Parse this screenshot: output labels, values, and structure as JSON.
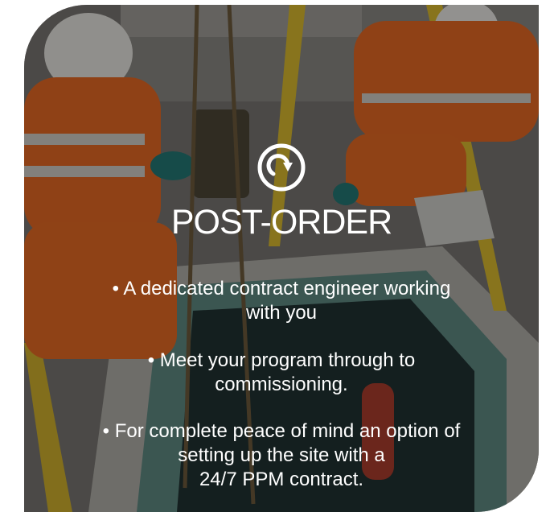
{
  "panel": {
    "title": "POST-ORDER",
    "icon": "redo-arrow-icon",
    "bullets": [
      {
        "line1": "• A dedicated contract engineer working",
        "line2": "with you"
      },
      {
        "line1": "• Meet your program through to",
        "line2": "commissioning."
      },
      {
        "line1": "• For complete peace of mind an option of",
        "line2": "setting up the site with a",
        "line3": "24/7 PPM contract."
      }
    ]
  }
}
